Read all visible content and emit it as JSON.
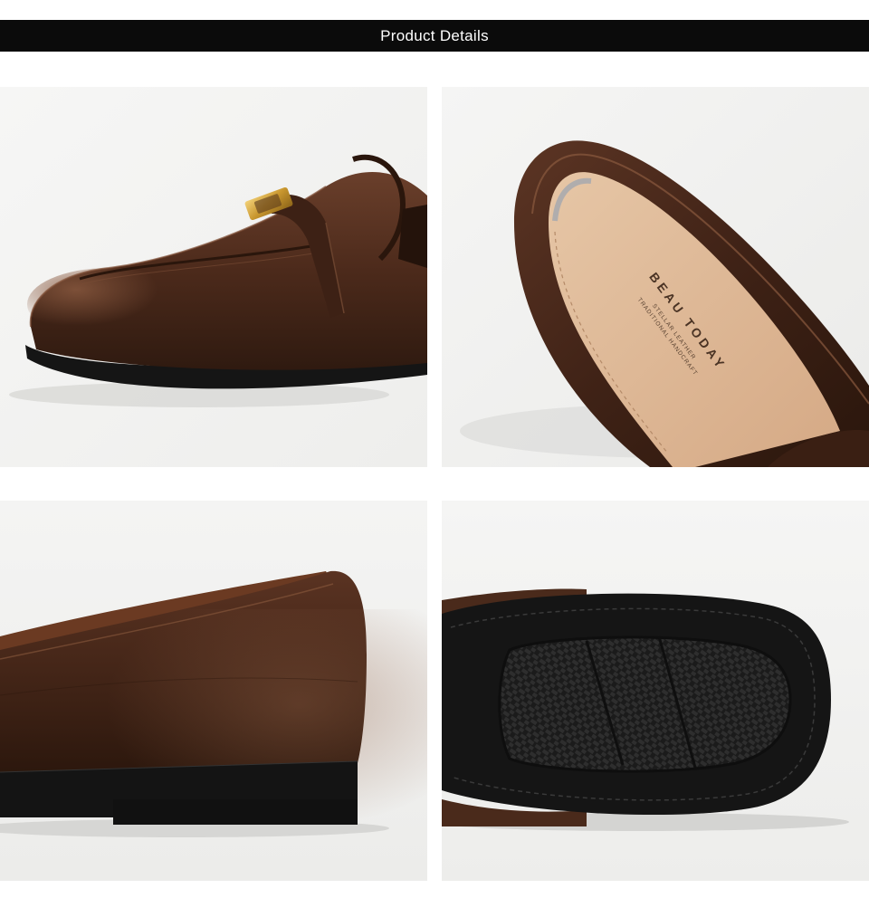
{
  "header": {
    "title": "Product Details"
  },
  "insole": {
    "brand": "BEAU TODAY",
    "line1": "STELLAR LEATHER",
    "line2": "TRADITIONAL HANDCRAFT"
  },
  "colors": {
    "banner": "#0b0b0b",
    "leather": "#4a2a1c",
    "sole": "#151515",
    "insole": "#dcb594",
    "panel_bg": "#f3f3f2"
  }
}
